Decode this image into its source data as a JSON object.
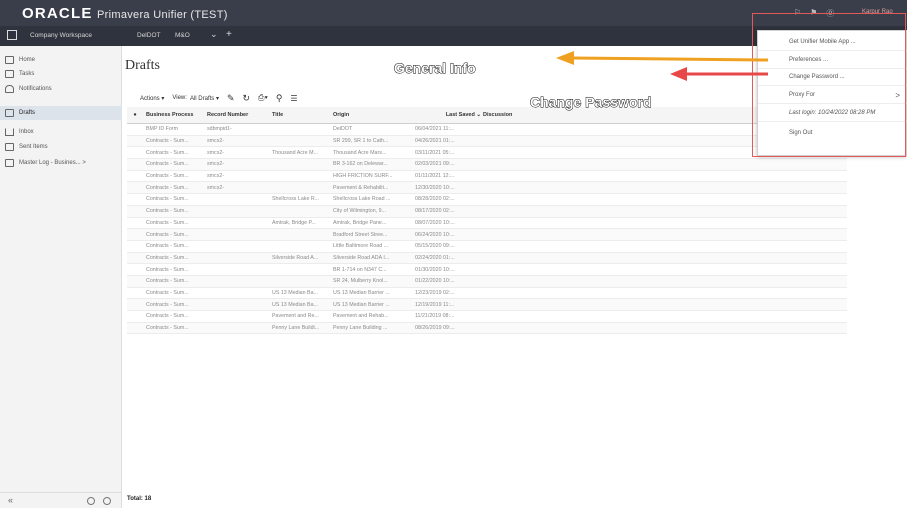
{
  "header": {
    "brand_oracle": "ORACLE",
    "brand_app": "Primavera Unifier (TEST)",
    "user_name": "Karpur Rao"
  },
  "nav": {
    "tabs": [
      "Company Workspace",
      "DelDOT",
      "M&O"
    ],
    "more_label": "⌄",
    "add_label": "+"
  },
  "sidebar": {
    "items": [
      {
        "label": "Home",
        "icon": "home-icon"
      },
      {
        "label": "Tasks",
        "icon": "tasks-icon"
      },
      {
        "label": "Notifications",
        "icon": "bell-icon"
      },
      {
        "label": "Drafts",
        "icon": "drafts-icon"
      },
      {
        "label": "Inbox",
        "icon": "inbox-icon"
      },
      {
        "label": "Sent Items",
        "icon": "sent-icon"
      },
      {
        "label": "Master Log - Busines... >",
        "icon": "log-icon"
      }
    ],
    "collapse_label": "«"
  },
  "main": {
    "title": "Drafts",
    "actions_label": "Actions ▾",
    "view_label": "View:",
    "view_value": "All Drafts ▾"
  },
  "grid": {
    "columns": [
      "Business Process",
      "Record Number",
      "Title",
      "Origin",
      "Last Saved ⌄",
      "Discussion"
    ],
    "rows": [
      [
        "BMP ID Form",
        "sdbmpid1-",
        "",
        "DelDOT",
        "06/04/2021 11:..."
      ],
      [
        "Contracts - Sum...",
        "smcs2-",
        "",
        "SR 299, SR 1 to Cath...",
        "04/26/2021 01:..."
      ],
      [
        "Contracts - Sum...",
        "smcs2-",
        "Thousand Acre M...",
        "Thousand Acre Mars...",
        "03/11/2021 05:..."
      ],
      [
        "Contracts - Sum...",
        "smcs2-",
        "",
        "BR 3-162 on Delewar...",
        "02/03/2021 09:..."
      ],
      [
        "Contracts - Sum...",
        "smcs2-",
        "",
        "HIGH FRICTION SURF...",
        "01/11/2021 12:..."
      ],
      [
        "Contracts - Sum...",
        "smcs2-",
        "",
        "Pavement & Rehabilit...",
        "12/30/2020 10:..."
      ],
      [
        "Contracts - Sum...",
        "",
        "Shellcross Lake R...",
        "Shellcross Lake Road ...",
        "08/28/2020 02:..."
      ],
      [
        "Contracts - Sum...",
        "",
        "",
        "City of Wilmington, 9...",
        "08/17/2020 02:..."
      ],
      [
        "Contracts - Sum...",
        "",
        "Amtrak, Bridge P...",
        "Amtrak, Bridge Pane...",
        "08/07/2020 10:..."
      ],
      [
        "Contracts - Sum...",
        "",
        "",
        "Bradford Street Stree...",
        "06/24/2020 10:..."
      ],
      [
        "Contracts - Sum...",
        "",
        "",
        "Little Baltimore Road ...",
        "05/15/2020 09:..."
      ],
      [
        "Contracts - Sum...",
        "",
        "Silverside Road A...",
        "Silverside Road ADA I...",
        "02/24/2020 01:..."
      ],
      [
        "Contracts - Sum...",
        "",
        "",
        "BR 1-714 on N347 C...",
        "01/30/2020 10:..."
      ],
      [
        "Contracts - Sum...",
        "",
        "",
        "SR 24, Mulberry Knol...",
        "01/22/2020 10:..."
      ],
      [
        "Contracts - Sum...",
        "",
        "US 13 Median Ba...",
        "US 13 Median Barrier ...",
        "12/23/2019 02:..."
      ],
      [
        "Contracts - Sum...",
        "",
        "US 13 Median Ba...",
        "US 13 Median Barrier ...",
        "12/19/2019 11:..."
      ],
      [
        "Contracts - Sum...",
        "",
        "Pavement and Re...",
        "Pavement and Rehab...",
        "11/21/2019 08:..."
      ],
      [
        "Contracts - Sum...",
        "",
        "Penny Lane Buildi...",
        "Penny Lane Building ...",
        "08/26/2019 09:..."
      ]
    ],
    "total_label": "Total: 18"
  },
  "user_menu": {
    "items": [
      "Get Unifier Mobile App ...",
      "Preferences ...",
      "Change Password ...",
      "Proxy For",
      "Last login: 10/24/2022 08:28 PM",
      "Sign Out"
    ],
    "proxy_chevron": ">"
  },
  "annotations": {
    "general_info": "General Info",
    "change_password": "Change Password",
    "arrow_general_color": "#f0a020",
    "arrow_password_color": "#e84848"
  }
}
